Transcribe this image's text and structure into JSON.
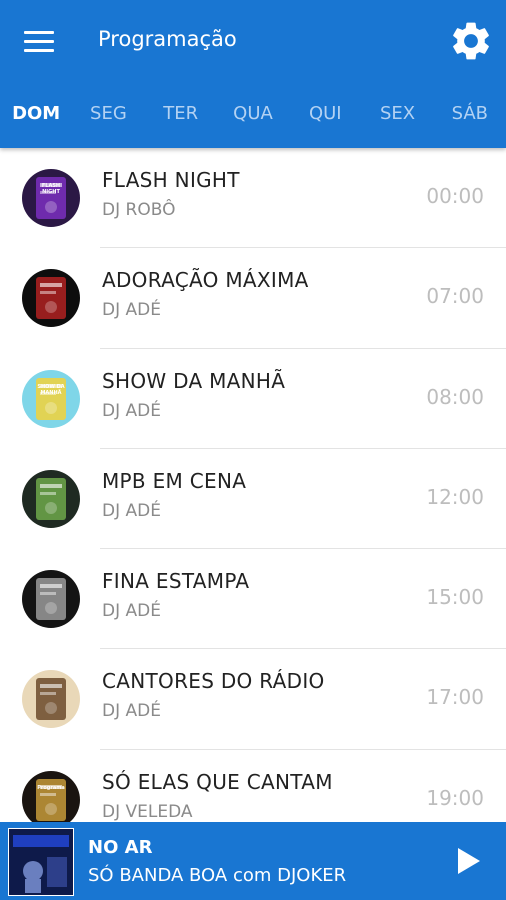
{
  "appbar": {
    "title": "Programação",
    "icons": {
      "menu": "menu-icon",
      "settings": "gear-icon"
    },
    "color": "#1976d2"
  },
  "tabs": [
    {
      "label": "DOM",
      "active": true
    },
    {
      "label": "SEG"
    },
    {
      "label": "TER"
    },
    {
      "label": "QUA"
    },
    {
      "label": "QUI"
    },
    {
      "label": "SEX"
    },
    {
      "label": "SÁB"
    }
  ],
  "shows": [
    {
      "name": "FLASH NIGHT",
      "dj": "DJ ROBÔ",
      "time": "00:00",
      "thumb_bg": "#2b1845",
      "thumb_accent": "#7b2fbf",
      "thumb_words": "FLASH NIGHT"
    },
    {
      "name": "ADORAÇÃO MÁXIMA",
      "dj": "DJ ADÉ",
      "time": "07:00",
      "thumb_bg": "#0d0d0d",
      "thumb_accent": "#b22222"
    },
    {
      "name": "SHOW DA MANHÃ",
      "dj": "DJ ADÉ",
      "time": "08:00",
      "thumb_bg": "#7fd6e8",
      "thumb_accent": "#f2d23a",
      "thumb_words": "SHOW DA MANHÃ"
    },
    {
      "name": "MPB EM CENA",
      "dj": "DJ ADÉ",
      "time": "12:00",
      "thumb_bg": "#1f2a22",
      "thumb_accent": "#6fa84a"
    },
    {
      "name": "FINA ESTAMPA",
      "dj": "DJ ADÉ",
      "time": "15:00",
      "thumb_bg": "#141414",
      "thumb_accent": "#9a9a9a"
    },
    {
      "name": "CANTORES DO RÁDIO",
      "dj": "DJ ADÉ",
      "time": "17:00",
      "thumb_bg": "#e9d8b8",
      "thumb_accent": "#6b4a2a"
    },
    {
      "name": "SÓ ELAS QUE CANTAM",
      "dj": "DJ VELEDA",
      "time": "19:00",
      "thumb_bg": "#1a1410",
      "thumb_accent": "#c79a3a",
      "thumb_words": "Programa"
    }
  ],
  "player": {
    "status": "NO AR",
    "now_playing": "SÓ BANDA BOA com DJOKER",
    "icon": "play-icon",
    "thumb_accent": "#1f3fbf"
  }
}
